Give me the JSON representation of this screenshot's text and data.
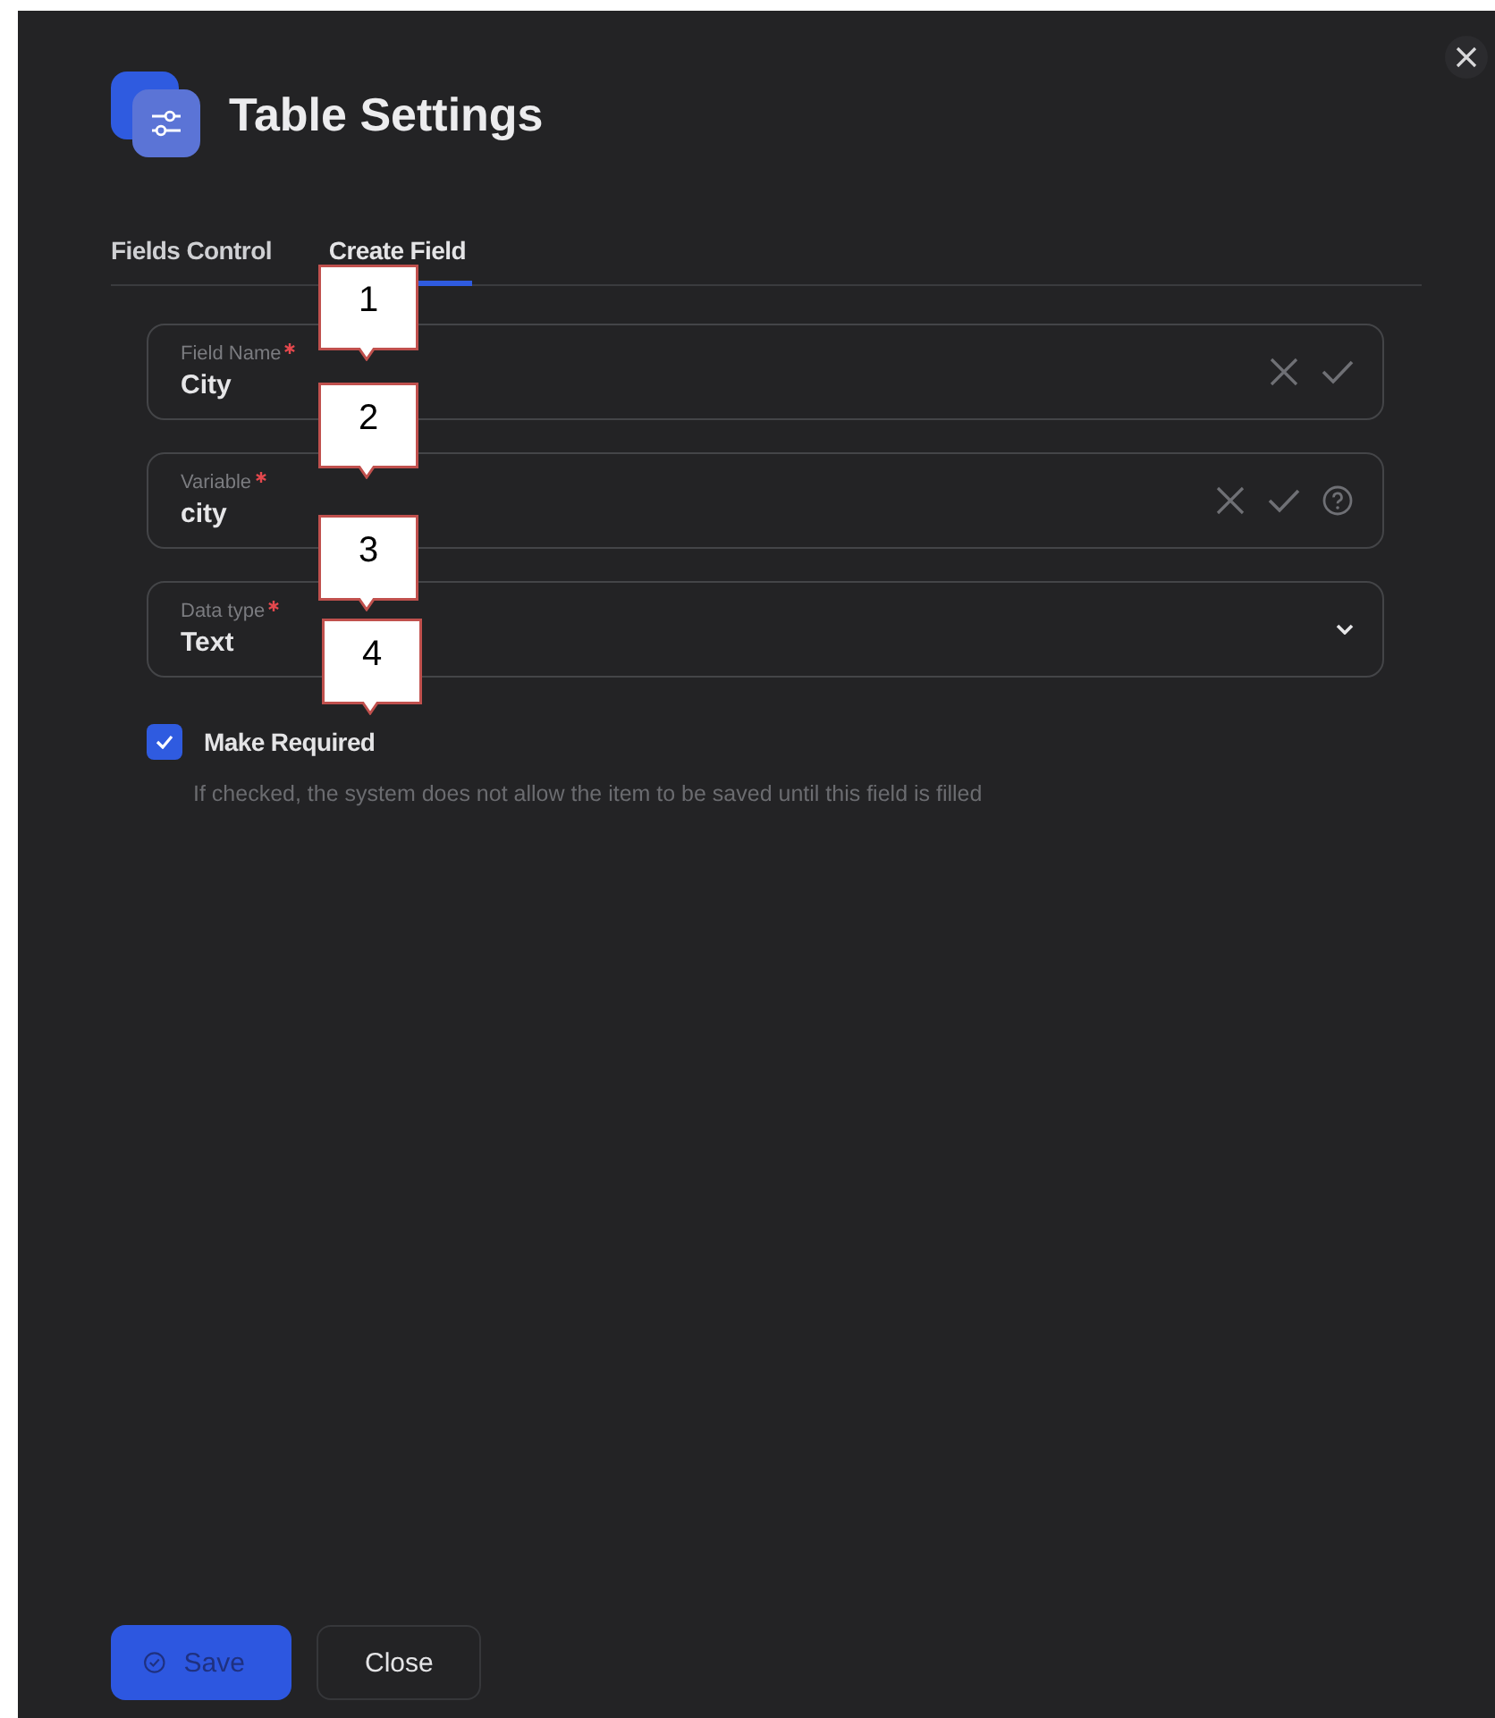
{
  "dialog": {
    "title": "Table Settings"
  },
  "tabs": [
    {
      "label": "Fields Control",
      "selected": false
    },
    {
      "label": "Create Field",
      "selected": true
    }
  ],
  "fields": [
    {
      "kind": "text",
      "label": "Field Name",
      "required": true,
      "value": "City",
      "help": false
    },
    {
      "kind": "text",
      "label": "Variable",
      "required": true,
      "value": "city",
      "help": true
    },
    {
      "kind": "select",
      "label": "Data type",
      "required": true,
      "value": "Text",
      "help": false
    }
  ],
  "checkbox": {
    "label": "Make Required",
    "checked": true,
    "hint": "If checked, the system does not allow the item to be saved until this field is filled"
  },
  "buttons": [
    {
      "label": "Save",
      "kind": "primary"
    },
    {
      "label": "Close",
      "kind": "secondary"
    }
  ],
  "callouts": [
    {
      "number": "1"
    },
    {
      "number": "2"
    },
    {
      "number": "3"
    },
    {
      "number": "4"
    }
  ]
}
